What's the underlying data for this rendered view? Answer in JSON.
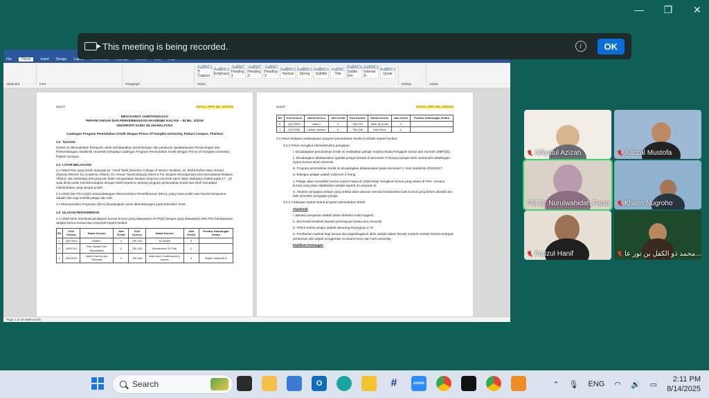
{
  "recording_banner": {
    "message": "This meeting is being recorded.",
    "ok_label": "OK",
    "icons": [
      "video-camera-icon",
      "info-icon"
    ]
  },
  "window_controls": {
    "minimize": "—",
    "restore": "❐",
    "close": "✕"
  },
  "shared_document": {
    "app": "Word",
    "tabs": [
      "File",
      "Home",
      "Insert",
      "Design",
      "Layout",
      "References",
      "Mailings",
      "Review",
      "View",
      "Help"
    ],
    "ribbon_groups": [
      "Clipboard",
      "Font",
      "Paragraph",
      "Styles",
      "Editing",
      "Adobe"
    ],
    "styles": [
      "¶ Caption",
      "Emphasis",
      "Heading 1",
      "Heading 2",
      "Heading 3",
      "Normal",
      "Strong",
      "Subtitle",
      "Title",
      "Subtle Em.",
      "Intense E.",
      "Quote"
    ],
    "status": "Page 1 of 19   4658 words",
    "page1": {
      "label": "SULIT",
      "ref": "Kertas JPPA BIL 40/2016",
      "title": [
        "MESYUARAT JAWATANKUASA",
        "PERANCANGAN DAN PERKEMBANGAN AKADEMIK KALI KE – 83 BIL. 4/2016",
        "UNIVERSITI SAINS ISLAM MALAYSIA"
      ],
      "subtitle": "Cadangan Program Pemindahan Kredit dengan Prince Of Songkla University, Pattani Campus, Thailand",
      "sections": [
        {
          "num": "1.0",
          "head": "TUJUAN",
          "text": "Kertas ini dikemukakan bertujuan untuk mendapatkan pertimbangan dan perakuan Jawatankuasa Perancangan dan Perkembangan Akademik Universiti terhadap Cadangan Program Pemindahan Kredit dengan Prince Of Songkla University, Pattani Campus."
        },
        {
          "num": "2.0",
          "head": "LATAR BELAKANG",
          "text": "2.1  Wakil PSU yang terdiri daripada Dr. Yusof Talek (Director, College of Islamic Studies), Dr. Mohd Roflee Wan Ahmad (Deputy Director for Academic Affairs), Dr. Asman Taeali (Deputy Director For Student Development and International Relation Affairs), dan beberapa ahli yang lain telah mengadakan lawatan kerja ke Universiti sains Islam Malaysia (USIM) pada 17 - 19 Julai 2016 untuk membincangkan dengan lebih terperinci tentang program pemindahan kredit dan telah mendapat maklumbalas yang sangat positif."
        },
        {
          "num": "",
          "head": "",
          "text": "2.2  USIM dan PSU telah menandatangani Memorandum Persefahaman (MoU), yang mana salah satu bentuk kerjasama adalah dari segi mobiliti pelajar dan staf."
        },
        {
          "num": "",
          "head": "",
          "text": "2.3  Memorandum Perjanjian (MoA) dicadangkan untuk ditandatangani pada Disember 2016."
        },
        {
          "num": "3.0",
          "head": "ULASAN PENTADBIRAN",
          "text": "3.1  USIM telah membuat penjajaran kursus-kursus yang ditawarkan di FPQS dengan yang ditawarkan oleh PSU berdasarkan rangka kursus kedua-dua Universiti seperti berikut:"
        }
      ],
      "table_header": [
        "Bil.",
        "Kod Kursus",
        "Nama Kursus",
        "Jam Kredit",
        "Kod Kursus",
        "Nama Kursus",
        "Jam Kredit",
        "Peratus Kandungan Setara"
      ],
      "table_rows": [
        [
          "1.",
          "QSF3043",
          "Hadith I",
          "3",
          "780-231",
          "Al-Hadith",
          "3",
          ""
        ],
        [
          "2.",
          "LBH1012",
          "Fiqh Ibadah Dan Munakahat",
          "2",
          "780-225",
          "Introduction To Fiqh",
          "3",
          ""
        ],
        [
          "3.",
          "AAC2013",
          "Islam Dan Isu-isu Semasa",
          "3",
          "780-336",
          "Islam and Contemporar y Issues",
          "3",
          "Rujuk Lampiran A"
        ]
      ]
    },
    "page2": {
      "label": "SULIT",
      "ref": "Kertas JPPA BIL 40/2016",
      "table_header": [
        "Bil.",
        "Kod Kursus",
        "Nama Kursus",
        "Jam Kredit",
        "Kod Kursus",
        "Nama Kursus",
        "Jam Kredit",
        "Peratus Kandungan Setara"
      ],
      "table_rows": [
        [
          "6.",
          "QQT3053",
          "Tafsir II",
          "3",
          "780-230",
          "Tafsir Al-Quran",
          "3",
          ""
        ],
        [
          "7.",
          "QUZ4036",
          "Latihan Industri",
          "6",
          "780-446",
          "Field Work",
          "6",
          ""
        ]
      ],
      "lines": [
        "3.2  Pelan tindakan pelaksanaan program pemindahan kredit ini adalah seperti berikut:",
        "3.2.1  Pelan mengikut silertai/struktur pengajian:",
        "i.  Dicadangkan pemindahan kredit ini melibatkan pelajar Sarjana Muda Pengajian Quran dan Sunnah (SMPQS).",
        "ii.  Dicadangkan dilaksanakan apabila pelajar berada di Semester IV kerana pelajar telah memenuhi sebahagian syarat kursus teras universiti.",
        "iii.  Program pemindahan kredit ini dicadangkan dilaksanakan pada Semester II, Sesi Akademik 2016/2017.",
        "iv.  Bilangan pelajar adalah minimum 2 orang.",
        "v.  Pelajar akan mendaftar kursus seperti biasa di USIM tetapi mengikuti kursus yang setara di PSU. Senarai kursus yang akan didaftarkan adalah seperti di Lampiran B.",
        "vi.  Struktur pengajian pelajar yang terlibat akan disusun semula berdasarkan baki kursus yang belum diambil dan baki semester pengajian pelajar.",
        "3.2.2  Cadangan syarat-syarat program pemindahan kredit",
        "Akademik",
        "i.  Bahasa pengantar adalah dalam Bahasa Arab/ Inggeris.",
        "ii.  Jam kredit tertakluk kepada persetujuan kedua-dua universiti",
        "iii.  PNGK terkini pelajar adalah sekurang-kurangnya 2.70.",
        "iv.  Pemberian markah bagi kursus dan pagiat/tugasan akhir adalah dalam bentuk markah mentah kerana terdapat perbezaan dari aspek penggredan di antara home dan host university.",
        "Implikasi Kewangan"
      ]
    }
  },
  "participants": [
    {
      "name": "Alfiyatul Azizah",
      "muted": true,
      "active": false,
      "bg": "#f2ede6"
    },
    {
      "name": "Asrizal Mustofa",
      "muted": true,
      "active": false,
      "bg": "#9fb8d4"
    },
    {
      "name": "PM Dr Nurulwahidah Fauzi",
      "muted": false,
      "active": true,
      "bg": "#d8d2c8"
    },
    {
      "name": "Kharis Nugroho",
      "muted": true,
      "active": false,
      "bg": "#8fb3cf"
    },
    {
      "name": "Fauzul Hanif",
      "muted": true,
      "active": false,
      "bg": "#e6e0d6"
    },
    {
      "name": "محمد ذو الكفل بن نور عا...",
      "muted": true,
      "active": false,
      "bg": "#1e4a2c"
    }
  ],
  "taskbar": {
    "search_placeholder": "Search",
    "apps": [
      "widgets",
      "file-explorer",
      "sticky",
      "whiteboard",
      "outlook",
      "edge",
      "folder",
      "hashtag",
      "zoom",
      "chrome",
      "capcut",
      "chrome-alt",
      "pdf"
    ],
    "language": "ENG",
    "time": "2:11 PM",
    "date": "8/14/2025"
  },
  "colors": {
    "desktop": "#0f5f57",
    "banner": "#1f2b2b",
    "ok": "#0b6dd8",
    "word_blue": "#2b579a",
    "active_outline": "#3ad36b",
    "mute_red": "#e0312f"
  }
}
